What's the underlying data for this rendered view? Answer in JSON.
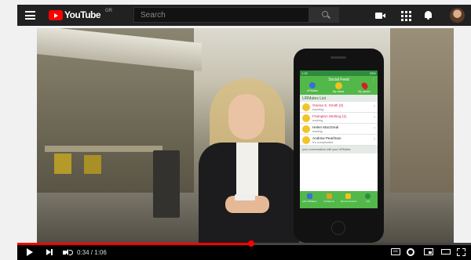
{
  "header": {
    "logo_text": "YouTube",
    "country_code": "GR",
    "search_placeholder": "Search"
  },
  "phone_app": {
    "status_time": "1:30",
    "status_right": "35%",
    "title": "Social Feed",
    "menu_glyph": "⋮",
    "top_actions": [
      "URMates",
      "My status",
      "My places"
    ],
    "list_header": "URMates List",
    "contacts": [
      {
        "name": "Geena S. Smith (2)",
        "status": "traveling",
        "highlight": true
      },
      {
        "name": "Frampton Sterling (1)",
        "status": "working",
        "highlight": true
      },
      {
        "name": "Helen MacGreal",
        "status": "reading",
        "highlight": false
      },
      {
        "name": "Andrew Pearlman",
        "status": "It's complicated",
        "highlight": false
      }
    ],
    "footer_note": "your conversations with your URMates",
    "bottom_actions": [
      "add URMates",
      "Invitations",
      "Mood moments",
      "Info"
    ]
  },
  "player": {
    "time_current": "0:34",
    "time_sep": " / ",
    "time_total": "1:06",
    "progress_fraction": 0.515,
    "cc_label": "CC"
  },
  "colors": {
    "youtube_red": "#ff0000",
    "app_green": "#53b84a",
    "highlight_name": "#d01c5c"
  },
  "icons": {
    "menu": "hamburger-icon",
    "create": "video-camera-icon",
    "apps": "grid-icon",
    "notifications": "bell-icon",
    "search": "search-icon"
  }
}
